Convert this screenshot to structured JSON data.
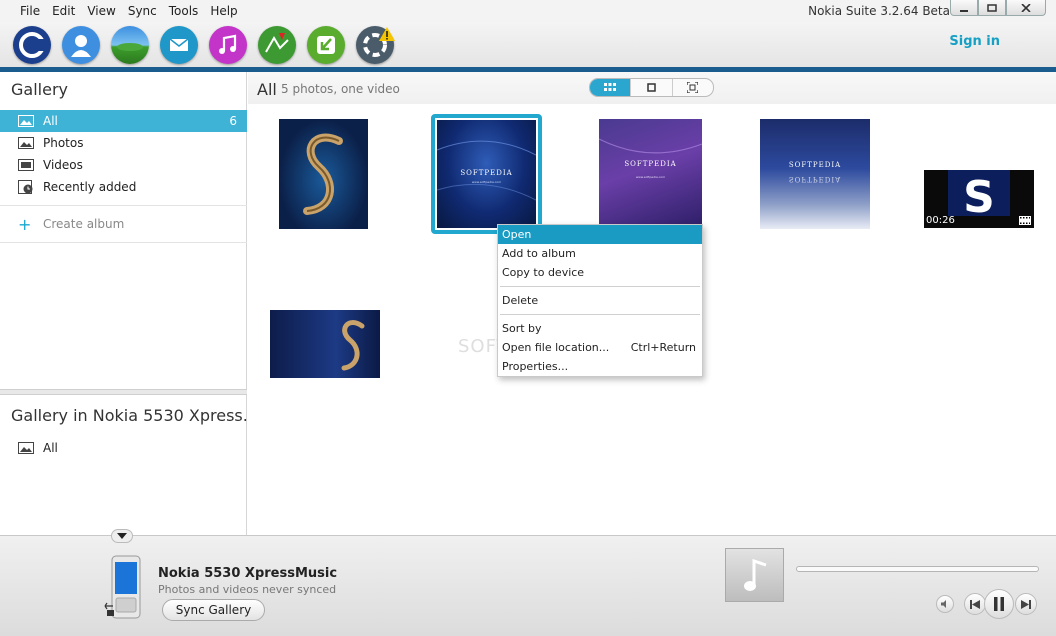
{
  "menubar": {
    "items": [
      "File",
      "Edit",
      "View",
      "Sync",
      "Tools",
      "Help"
    ],
    "app_title": "Nokia Suite 3.2.64 Beta"
  },
  "toolbar": {
    "icons": [
      "home-icon",
      "contacts-icon",
      "gallery-icon",
      "messages-icon",
      "music-icon",
      "maps-icon",
      "software-update-icon",
      "support-icon"
    ],
    "sign_in": "Sign in"
  },
  "sidebar": {
    "title": "Gallery",
    "items": [
      {
        "label": "All",
        "count": "6",
        "icon": "image-icon"
      },
      {
        "label": "Photos",
        "icon": "photo-icon"
      },
      {
        "label": "Videos",
        "icon": "film-icon"
      },
      {
        "label": "Recently added",
        "icon": "recent-icon"
      }
    ],
    "create_album": "Create album",
    "device_section_title": "Gallery in Nokia 5530 Xpress...",
    "device_items": [
      {
        "label": "All"
      }
    ]
  },
  "main": {
    "title": "All",
    "subtitle": "5 photos, one video",
    "video_duration": "00:26"
  },
  "context_menu": {
    "items": [
      {
        "label": "Open"
      },
      {
        "label": "Add to album"
      },
      {
        "label": "Copy to device"
      },
      {
        "label": "Delete"
      },
      {
        "label": "Sort by"
      },
      {
        "label": "Open file location...",
        "shortcut": "Ctrl+Return"
      },
      {
        "label": "Properties..."
      }
    ]
  },
  "bottom": {
    "device_name": "Nokia 5530 XpressMusic",
    "device_status": "Photos and videos never synced",
    "sync_button": "Sync Gallery"
  },
  "colors": {
    "accent": "#3fb3d6",
    "selection_frame": "#22a7cf",
    "menu_highlight": "#199bc4",
    "toolbar_line": "#1a5c8e"
  }
}
